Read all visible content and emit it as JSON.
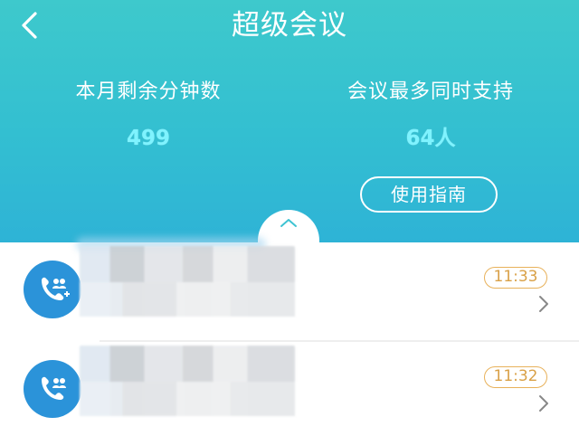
{
  "header": {
    "title": "超级会议",
    "back_icon": "chevron-left-icon",
    "stats": [
      {
        "label": "本月剩余分钟数",
        "value": "499"
      },
      {
        "label": "会议最多同时支持",
        "value": "64人"
      }
    ],
    "guide_label": "使用指南",
    "collapse_icon": "chevron-up-icon"
  },
  "list": {
    "items": [
      {
        "avatar_icon": "group-call-icon",
        "name": "",
        "time": "11:33",
        "chevron_icon": "chevron-right-icon"
      },
      {
        "avatar_icon": "group-call-icon",
        "name": "",
        "time": "11:32",
        "chevron_icon": "chevron-right-icon"
      }
    ]
  },
  "colors": {
    "header_gradient_top": "#3ec9cc",
    "header_gradient_bottom": "#2eb3d6",
    "stat_value": "#7ff3ff",
    "avatar": "#2b93d9",
    "time_badge": "#e8b15a"
  }
}
